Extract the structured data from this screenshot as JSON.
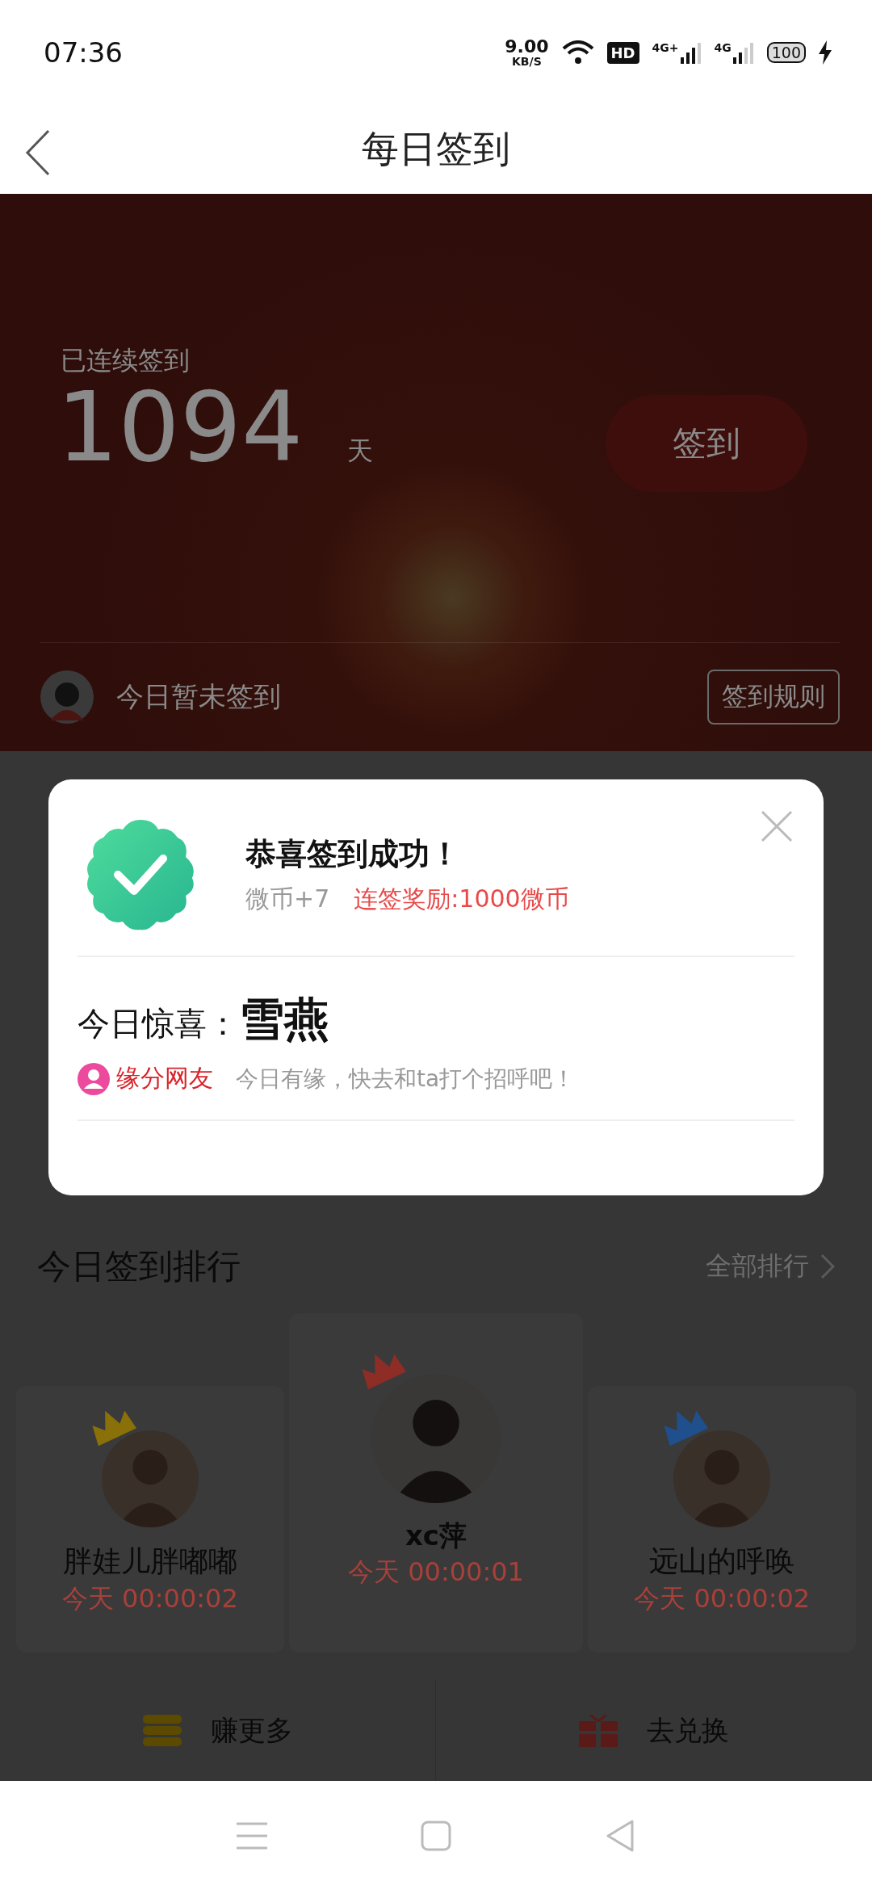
{
  "status_bar": {
    "time": "07:36",
    "net_speed": "9.00",
    "net_unit": "KB/S",
    "hd": "HD",
    "signals": [
      {
        "label": "4G+"
      },
      {
        "label": "4G"
      }
    ],
    "battery": "100"
  },
  "header": {
    "title": "每日签到"
  },
  "checkin_card": {
    "streak_label": "已连续签到",
    "streak_count": "1094",
    "streak_unit": "天",
    "checkin_button": "签到",
    "status_text": "今日暂未签到",
    "rules_button": "签到规则"
  },
  "dialog": {
    "title": "恭喜签到成功！",
    "coin_reward": "微币+7",
    "streak_reward": "连签奖励:1000微币",
    "surprise_label": "今日惊喜：",
    "surprise_value": "雪燕",
    "tag": "缘分网友",
    "tag_text": "今日有缘，快去和ta打个招呼吧！"
  },
  "ranking": {
    "title": "今日签到排行",
    "more": "全部排行",
    "entries": [
      {
        "name": "胖娃儿胖嘟嘟",
        "time": "今天 00:00:02",
        "kind": "side",
        "color": "#8a7008"
      },
      {
        "name": "xc萍",
        "time": "今天 00:00:01",
        "kind": "top",
        "color": "#8e2c26"
      },
      {
        "name": "远山的呼唤",
        "time": "今天 00:00:02",
        "kind": "side",
        "color": "#1f4f8c"
      }
    ]
  },
  "bottom_actions": [
    {
      "label": "赚更多",
      "kind": "coins"
    },
    {
      "label": "去兑换",
      "kind": "gift"
    }
  ]
}
